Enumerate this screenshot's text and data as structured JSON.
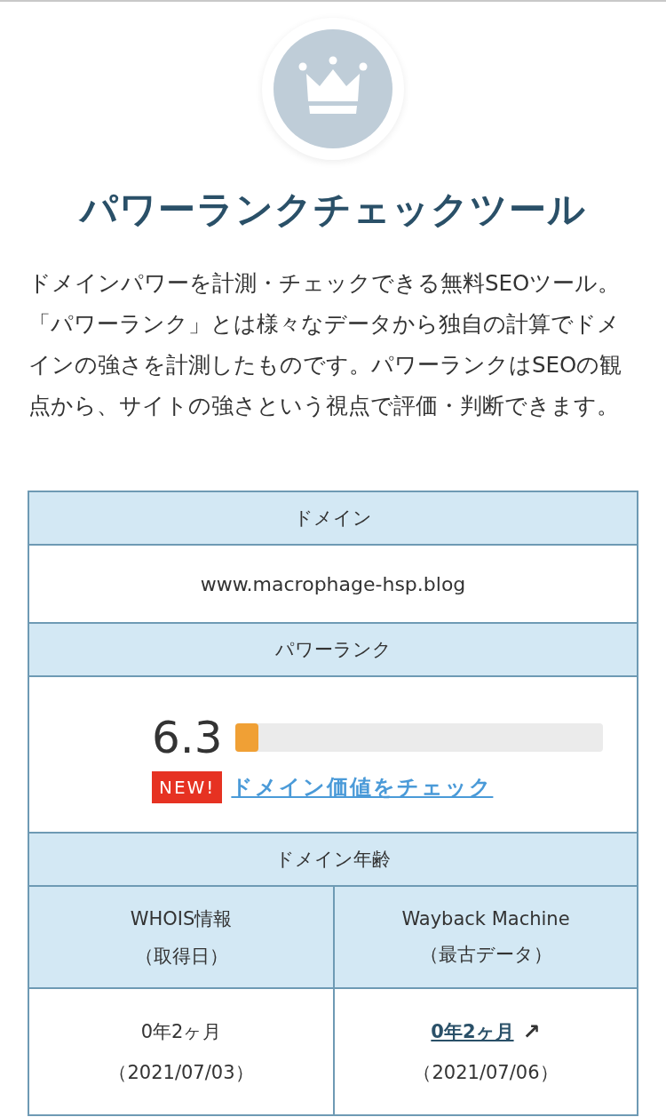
{
  "title": "パワーランクチェックツール",
  "intro": "ドメインパワーを計測・チェックできる無料SEOツール。「パワーランク」とは様々なデータから独自の計算でドメインの強さを計測したものです。パワーランクはSEOの観点から、サイトの強さという視点で評価・判断できます。",
  "domain": {
    "heading": "ドメイン",
    "value": "www.macrophage-hsp.blog"
  },
  "power_rank": {
    "heading": "パワーランク",
    "score": "6.3",
    "level": 0.063,
    "badge": "NEW!",
    "link": "ドメイン価値をチェック"
  },
  "domain_age": {
    "heading": "ドメイン年齢",
    "columns": [
      {
        "title": "WHOIS情報",
        "subtitle": "（取得日）",
        "age": "0年2ヶ月",
        "date": "（2021/07/03）",
        "linked": false
      },
      {
        "title": "Wayback Machine",
        "subtitle": "（最古データ）",
        "age": "0年2ヶ月",
        "date": "（2021/07/06）",
        "linked": true,
        "arrow": "↗"
      }
    ]
  }
}
